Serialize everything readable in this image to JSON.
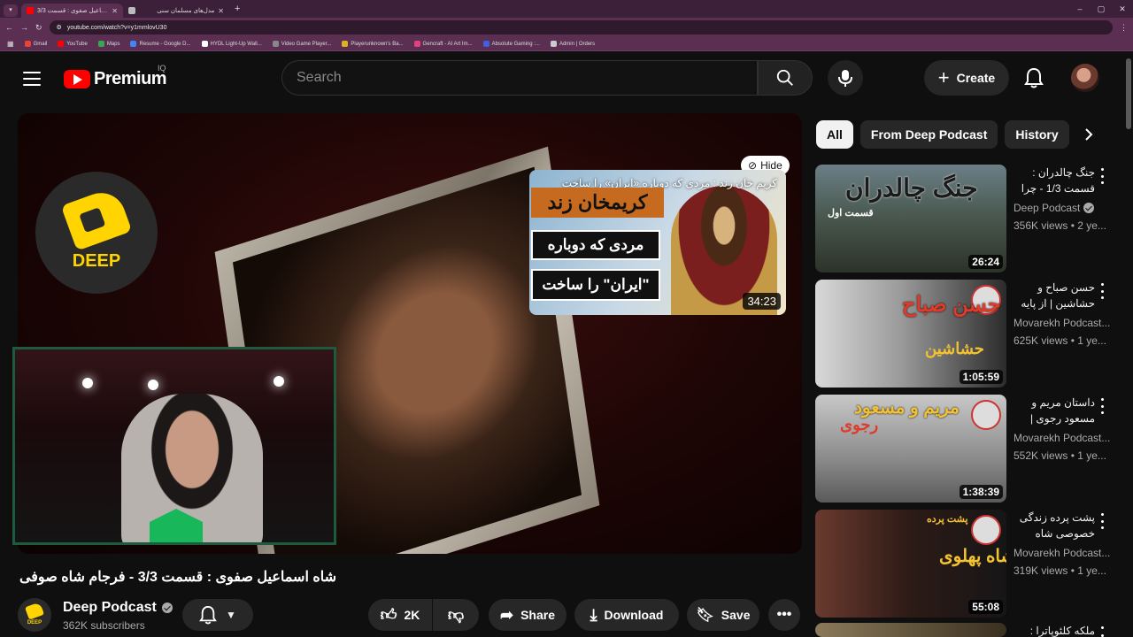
{
  "browser": {
    "tabs": [
      {
        "title": "شاه اسماعیل صفوی : قسمت 3/3"
      },
      {
        "title": "مدل‌های مسلمان سنی"
      }
    ],
    "url": "youtube.com/watch?v=y1mmlovU30",
    "bookmarks": [
      {
        "label": "Gmail",
        "color": "#ea4335"
      },
      {
        "label": "YouTube",
        "color": "#ff0000"
      },
      {
        "label": "Maps",
        "color": "#34a853"
      },
      {
        "label": "Resume - Google D...",
        "color": "#4285f4"
      },
      {
        "label": "HYDL Light-Up Wall...",
        "color": "#ffffff"
      },
      {
        "label": "Video Game Player...",
        "color": "#888888"
      },
      {
        "label": "Playerunknown's Ba...",
        "color": "#e0b020"
      },
      {
        "label": "Gencraft - AI Art Im...",
        "color": "#e04080"
      },
      {
        "label": "Absolute Gaming :...",
        "color": "#4060e0"
      },
      {
        "label": "Admin | Orders",
        "color": "#cccccc"
      }
    ]
  },
  "header": {
    "logo_text": "Premium",
    "country_code": "IQ",
    "search_placeholder": "Search",
    "create_label": "Create"
  },
  "player": {
    "brand_text": "DEEP",
    "hide_label": "Hide",
    "endcard": {
      "title": "کریم خان زند : مردی که دوباره «ایران» را ساخت",
      "line1": "کریمخان زند",
      "line2": "مردی که دوباره",
      "line3": "\"ایران\" را ساخت",
      "duration": "34:23"
    }
  },
  "video": {
    "title": "شاه اسماعیل صفوی : قسمت 3/3 - فرجام شاه صوفی",
    "channel": "Deep Podcast",
    "subscribers": "362K subscribers",
    "channel_avatar_text": "DEEP",
    "likes": "2K",
    "share_label": "Share",
    "download_label": "Download",
    "save_label": "Save"
  },
  "chips": [
    "All",
    "From Deep Podcast",
    "History"
  ],
  "recommendations": [
    {
      "title": "جنگ چالدران : قسمت 1/3 - چرا",
      "channel": "Deep Podcast",
      "verified": true,
      "meta": "356K views • 2 ye...",
      "duration": "26:24",
      "thumb_text": "جنگ چالدران",
      "thumb_sub": "قسمت اول"
    },
    {
      "title": "حسن صباح و حشاشین | از پایه",
      "channel": "Movarekh Podcast...",
      "verified": false,
      "meta": "625K views • 1 ye...",
      "duration": "1:05:59",
      "thumb_text": "حسن صباح",
      "thumb_sub": "حشاشین"
    },
    {
      "title": "داستان مریم و مسعود رجوی |",
      "channel": "Movarekh Podcast...",
      "verified": false,
      "meta": "552K views • 1 ye...",
      "duration": "1:38:39",
      "thumb_text": "مریم و مسعود",
      "thumb_sub": "رجوی"
    },
    {
      "title": "پشت پرده زندگی خصوصی شاه",
      "channel": "Movarekh Podcast...",
      "verified": false,
      "meta": "319K views • 1 ye...",
      "duration": "55:08",
      "thumb_text": "شاه پهلوی",
      "thumb_sub": "پشت پرده"
    },
    {
      "title": "ملکه کلئوپاترا :",
      "channel": "",
      "verified": false,
      "meta": "",
      "duration": "",
      "thumb_text": "",
      "thumb_sub": ""
    }
  ]
}
